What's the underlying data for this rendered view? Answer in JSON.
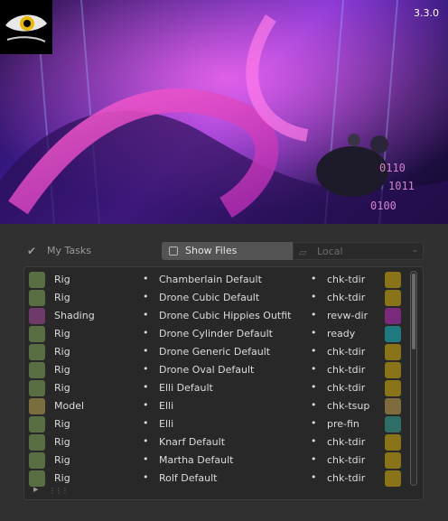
{
  "splash": {
    "version": "3.3.0",
    "logo_icon": "blender-eye-logo-icon"
  },
  "toolbar": {
    "my_tasks_label": "My Tasks",
    "show_files_label": "Show Files",
    "location_value": "Local"
  },
  "rows": [
    {
      "type": "Rig",
      "asset": "Chamberlain Default",
      "status": "chk-tdir",
      "type_color": "#5a6e43",
      "status_color": "#8a7418"
    },
    {
      "type": "Rig",
      "asset": "Drone Cubic Default",
      "status": "chk-tdir",
      "type_color": "#5a6e43",
      "status_color": "#8a7418"
    },
    {
      "type": "Shading",
      "asset": "Drone Cubic Hippies Outfit",
      "status": "revw-dir",
      "type_color": "#6e3a6a",
      "status_color": "#7a2a7a"
    },
    {
      "type": "Rig",
      "asset": "Drone Cylinder Default",
      "status": "ready",
      "type_color": "#5a6e43",
      "status_color": "#1f7a80"
    },
    {
      "type": "Rig",
      "asset": "Drone Generic Default",
      "status": "chk-tdir",
      "type_color": "#5a6e43",
      "status_color": "#8a7418"
    },
    {
      "type": "Rig",
      "asset": "Drone Oval Default",
      "status": "chk-tdir",
      "type_color": "#5a6e43",
      "status_color": "#8a7418"
    },
    {
      "type": "Rig",
      "asset": "Elli Default",
      "status": "chk-tdir",
      "type_color": "#5a6e43",
      "status_color": "#8a7418"
    },
    {
      "type": "Model",
      "asset": "Elli",
      "status": "chk-tsup",
      "type_color": "#7a6e3e",
      "status_color": "#7e6c3e"
    },
    {
      "type": "Rig",
      "asset": "Elli",
      "status": "pre-fin",
      "type_color": "#5a6e43",
      "status_color": "#2f6e66"
    },
    {
      "type": "Rig",
      "asset": "Knarf Default",
      "status": "chk-tdir",
      "type_color": "#5a6e43",
      "status_color": "#8a7418"
    },
    {
      "type": "Rig",
      "asset": "Martha Default",
      "status": "chk-tdir",
      "type_color": "#5a6e43",
      "status_color": "#8a7418"
    },
    {
      "type": "Rig",
      "asset": "Rolf Default",
      "status": "chk-tdir",
      "type_color": "#5a6e43",
      "status_color": "#8a7418"
    }
  ],
  "bullet": "•"
}
